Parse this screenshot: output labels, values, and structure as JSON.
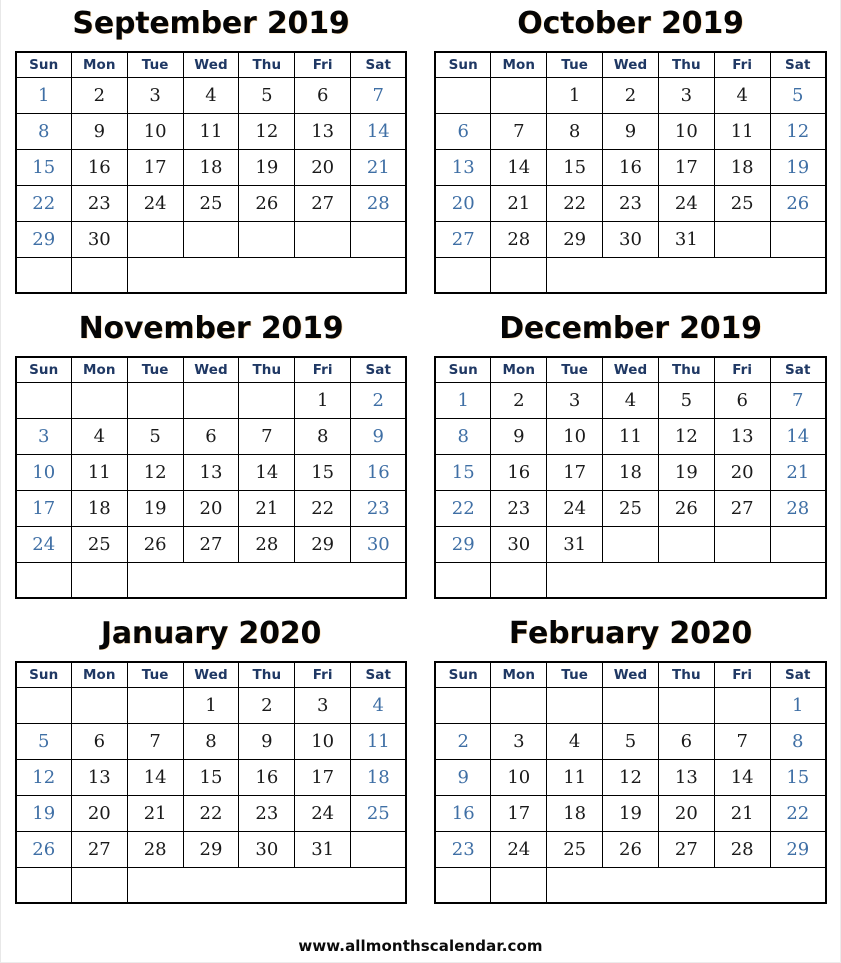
{
  "page": {
    "footer_url": "www.allmonthscalendar.com",
    "accent_header_color": "#1F3864",
    "weekend_color": "#3F6FA5",
    "weekday_color": "#1A1A1A",
    "border_color": "#000000",
    "background_color": "#FFFFFF"
  },
  "weekdays": [
    "Sun",
    "Mon",
    "Tue",
    "Wed",
    "Thu",
    "Fri",
    "Sat"
  ],
  "months": [
    {
      "title": "September 2019",
      "name": "September",
      "year": "2019",
      "weeks": [
        [
          "1",
          "2",
          "3",
          "4",
          "5",
          "6",
          "7"
        ],
        [
          "8",
          "9",
          "10",
          "11",
          "12",
          "13",
          "14"
        ],
        [
          "15",
          "16",
          "17",
          "18",
          "19",
          "20",
          "21"
        ],
        [
          "22",
          "23",
          "24",
          "25",
          "26",
          "27",
          "28"
        ],
        [
          "29",
          "30",
          "",
          "",
          "",
          "",
          ""
        ]
      ]
    },
    {
      "title": "October 2019",
      "name": "October",
      "year": "2019",
      "weeks": [
        [
          "",
          "",
          "1",
          "2",
          "3",
          "4",
          "5"
        ],
        [
          "6",
          "7",
          "8",
          "9",
          "10",
          "11",
          "12"
        ],
        [
          "13",
          "14",
          "15",
          "16",
          "17",
          "18",
          "19"
        ],
        [
          "20",
          "21",
          "22",
          "23",
          "24",
          "25",
          "26"
        ],
        [
          "27",
          "28",
          "29",
          "30",
          "31",
          "",
          ""
        ]
      ]
    },
    {
      "title": "November 2019",
      "name": "November",
      "year": "2019",
      "weeks": [
        [
          "",
          "",
          "",
          "",
          "",
          "1",
          "2"
        ],
        [
          "3",
          "4",
          "5",
          "6",
          "7",
          "8",
          "9"
        ],
        [
          "10",
          "11",
          "12",
          "13",
          "14",
          "15",
          "16"
        ],
        [
          "17",
          "18",
          "19",
          "20",
          "21",
          "22",
          "23"
        ],
        [
          "24",
          "25",
          "26",
          "27",
          "28",
          "29",
          "30"
        ]
      ]
    },
    {
      "title": "December 2019",
      "name": "December",
      "year": "2019",
      "weeks": [
        [
          "1",
          "2",
          "3",
          "4",
          "5",
          "6",
          "7"
        ],
        [
          "8",
          "9",
          "10",
          "11",
          "12",
          "13",
          "14"
        ],
        [
          "15",
          "16",
          "17",
          "18",
          "19",
          "20",
          "21"
        ],
        [
          "22",
          "23",
          "24",
          "25",
          "26",
          "27",
          "28"
        ],
        [
          "29",
          "30",
          "31",
          "",
          "",
          "",
          ""
        ]
      ]
    },
    {
      "title": "January 2020",
      "name": "January",
      "year": "2020",
      "weeks": [
        [
          "",
          "",
          "",
          "1",
          "2",
          "3",
          "4"
        ],
        [
          "5",
          "6",
          "7",
          "8",
          "9",
          "10",
          "11"
        ],
        [
          "12",
          "13",
          "14",
          "15",
          "16",
          "17",
          "18"
        ],
        [
          "19",
          "20",
          "21",
          "22",
          "23",
          "24",
          "25"
        ],
        [
          "26",
          "27",
          "28",
          "29",
          "30",
          "31",
          ""
        ]
      ]
    },
    {
      "title": "February 2020",
      "name": "February",
      "year": "2020",
      "weeks": [
        [
          "",
          "",
          "",
          "",
          "",
          "",
          "1"
        ],
        [
          "2",
          "3",
          "4",
          "5",
          "6",
          "7",
          "8"
        ],
        [
          "9",
          "10",
          "11",
          "12",
          "13",
          "14",
          "15"
        ],
        [
          "16",
          "17",
          "18",
          "19",
          "20",
          "21",
          "22"
        ],
        [
          "23",
          "24",
          "25",
          "26",
          "27",
          "28",
          "29"
        ]
      ]
    }
  ]
}
